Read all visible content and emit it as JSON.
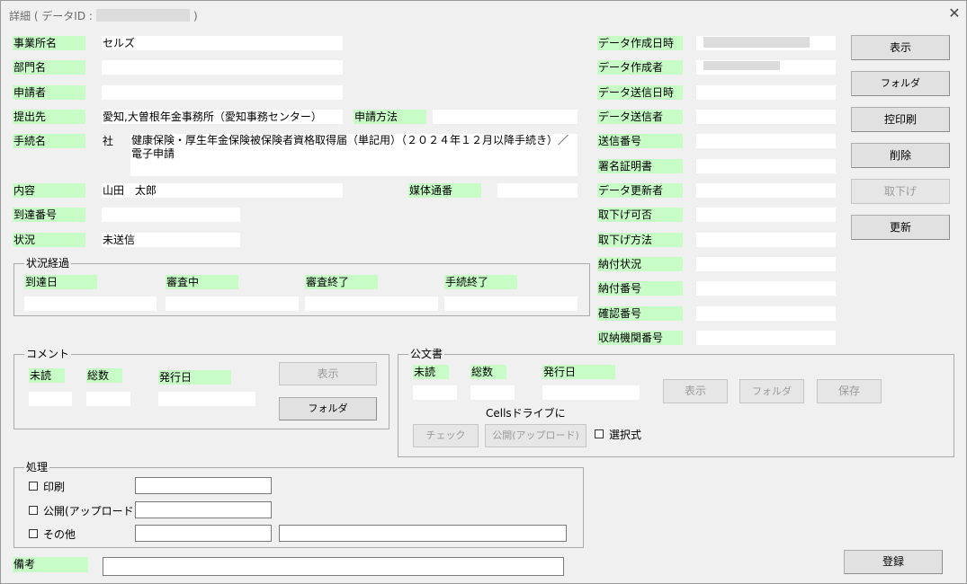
{
  "window": {
    "title_prefix": "詳細 ( データID :",
    "title_suffix": ")",
    "close_label": "✕"
  },
  "left": {
    "jigyousho_label": "事業所名",
    "jigyousho_value": "セルズ",
    "bumon_label": "部門名",
    "bumon_value": "",
    "shinseisha_label": "申請者",
    "shinseisha_value": "",
    "teishutsusaki_label": "提出先",
    "teishutsusaki_value": "愛知,大曽根年金事務所（愛知事務センター）",
    "shinsei_houhou_label": "申請方法",
    "shinsei_houhou_value": "",
    "tetsuzuki_label": "手続名",
    "tetsuzuki_prefix": "社",
    "tetsuzuki_value": "健康保険・厚生年金保険被保険者資格取得届（単記用）（２０２４年１２月以降手続き）／電子申請",
    "naiyou_label": "内容",
    "naiyou_value": "山田　太郎",
    "baitai_label": "媒体通番",
    "baitai_value": "",
    "toutatsu_bangou_label": "到達番号",
    "toutatsu_bangou_value": "",
    "joukyou_label": "状況",
    "joukyou_value": "未送信"
  },
  "status_group": {
    "title": "状況経過",
    "toutatsubi_label": "到達日",
    "shinsachu_label": "審査中",
    "shinsa_shuryo_label": "審査終了",
    "tetsuzuki_shuryo_label": "手続終了"
  },
  "comment_group": {
    "title": "コメント",
    "midoku_label": "未読",
    "soukazu_label": "総数",
    "hakkoubi_label": "発行日",
    "show_button": "表示",
    "folder_button": "フォルダ"
  },
  "official_group": {
    "title": "公文書",
    "midoku_label": "未読",
    "soukazu_label": "総数",
    "hakkoubi_label": "発行日",
    "show_button": "表示",
    "folder_button": "フォルダ",
    "save_button": "保存",
    "cells_text": "Cellsドライブに",
    "check_button": "チェック",
    "publish_button": "公開(アップロード)",
    "select_label": "選択式"
  },
  "process_group": {
    "title": "処理",
    "print_label": "印刷",
    "publish_label": "公開(アップロード)",
    "other_label": "その他"
  },
  "bikou_label": "備考",
  "register_button": "登録",
  "right": {
    "created_at_label": "データ作成日時",
    "creator_label": "データ作成者",
    "sent_at_label": "データ送信日時",
    "sender_label": "データ送信者",
    "send_number_label": "送信番号",
    "signature_label": "署名証明書",
    "updater_label": "データ更新者",
    "withdraw_possible_label": "取下げ可否",
    "withdraw_method_label": "取下げ方法",
    "payment_status_label": "納付状況",
    "payment_number_label": "納付番号",
    "confirm_number_label": "確認番号",
    "receiving_agency_label": "収納機関番号"
  },
  "buttons": {
    "show": "表示",
    "folder": "フォルダ",
    "copy_print": "控印刷",
    "delete": "削除",
    "withdraw": "取下げ",
    "update": "更新"
  }
}
